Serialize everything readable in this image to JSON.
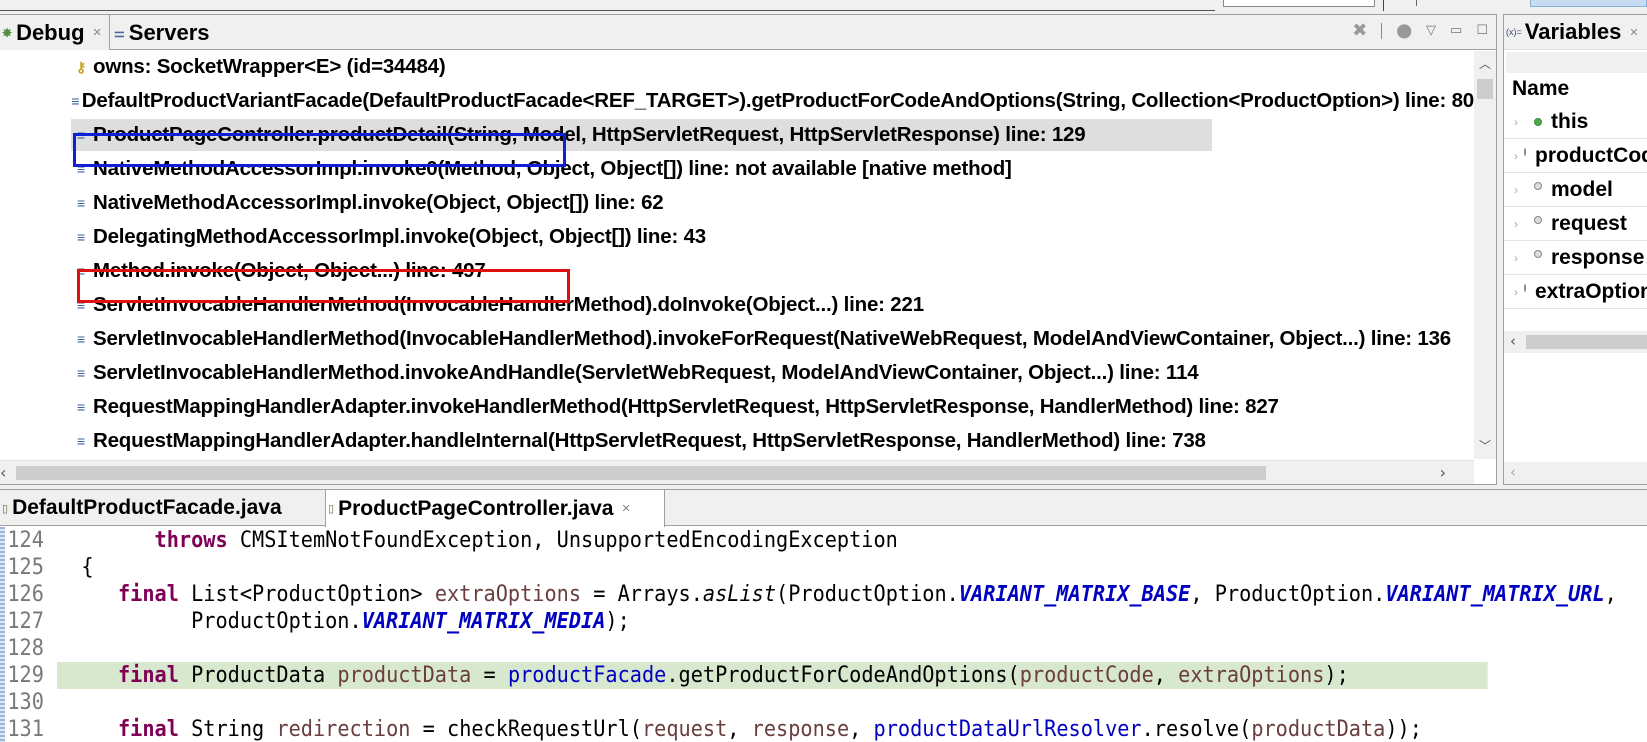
{
  "debug_view": {
    "tabs": [
      {
        "label": "Debug",
        "icon": "bug-icon",
        "closable": true,
        "active": true
      },
      {
        "label": "Servers",
        "icon": "servers-icon",
        "closable": false,
        "active": false
      }
    ],
    "toolbar": [
      "remove-all-terminated-icon",
      "debug-threads-icon",
      "view-menu-icon",
      "minimize-icon",
      "maximize-icon"
    ],
    "stack_frames": [
      {
        "icon": "key-icon",
        "text": "owns: SocketWrapper<E>  (id=34484)"
      },
      {
        "icon": "stack-frame-icon",
        "text": "DefaultProductVariantFacade(DefaultProductFacade<REF_TARGET>).getProductForCodeAndOptions(String, Collection<ProductOption>) line: 80"
      },
      {
        "icon": "stack-frame-icon",
        "text": "ProductPageController.productDetail(String, Model, HttpServletRequest, HttpServletResponse) line: 129",
        "selected": true
      },
      {
        "icon": "stack-frame-icon",
        "text": "NativeMethodAccessorImpl.invoke0(Method, Object, Object[]) line: not available [native method]"
      },
      {
        "icon": "stack-frame-icon",
        "text": "NativeMethodAccessorImpl.invoke(Object, Object[]) line: 62"
      },
      {
        "icon": "stack-frame-icon",
        "text": "DelegatingMethodAccessorImpl.invoke(Object, Object[]) line: 43"
      },
      {
        "icon": "stack-frame-icon",
        "text": "Method.invoke(Object, Object...) line: 497"
      },
      {
        "icon": "stack-frame-icon",
        "text": "ServletInvocableHandlerMethod(InvocableHandlerMethod).doInvoke(Object...) line: 221"
      },
      {
        "icon": "stack-frame-icon",
        "text": "ServletInvocableHandlerMethod(InvocableHandlerMethod).invokeForRequest(NativeWebRequest, ModelAndViewContainer, Object...) line: 136"
      },
      {
        "icon": "stack-frame-icon",
        "text": "ServletInvocableHandlerMethod.invokeAndHandle(ServletWebRequest, ModelAndViewContainer, Object...) line: 114"
      },
      {
        "icon": "stack-frame-icon",
        "text": "RequestMappingHandlerAdapter.invokeHandlerMethod(HttpServletRequest, HttpServletResponse, HandlerMethod) line: 827"
      },
      {
        "icon": "stack-frame-icon",
        "text": "RequestMappingHandlerAdapter.handleInternal(HttpServletRequest, HttpServletResponse, HandlerMethod) line: 738"
      }
    ],
    "annotations": {
      "blue_box_color": "#1020d8",
      "red_box_color": "#e01010"
    }
  },
  "variables_view": {
    "tab": {
      "label": "Variables",
      "icon": "variables-icon",
      "closable": true
    },
    "column_header": "Name",
    "rows": [
      {
        "name": "this",
        "kind": "field"
      },
      {
        "name": "productCode",
        "kind": "local"
      },
      {
        "name": "model",
        "kind": "local"
      },
      {
        "name": "request",
        "kind": "local"
      },
      {
        "name": "response",
        "kind": "local"
      },
      {
        "name": "extraOptions",
        "kind": "local"
      }
    ]
  },
  "editor": {
    "tabs": [
      {
        "label": "DefaultProductFacade.java",
        "icon": "java-file-icon",
        "active": false
      },
      {
        "label": "ProductPageController.java",
        "icon": "java-file-icon",
        "active": true,
        "closable": true
      }
    ],
    "current_line": 129,
    "lines": [
      {
        "num": "124",
        "tokens": [
          [
            "",
            "        "
          ],
          [
            "kw",
            "throws"
          ],
          [
            "",
            " CMSItemNotFoundException, UnsupportedEncodingException"
          ]
        ]
      },
      {
        "num": "125",
        "tokens": [
          [
            "",
            "  {"
          ]
        ]
      },
      {
        "num": "126",
        "tokens": [
          [
            "",
            "     "
          ],
          [
            "kw",
            "final"
          ],
          [
            "",
            " List<ProductOption> "
          ],
          [
            "var",
            "extraOptions"
          ],
          [
            "",
            " = Arrays."
          ],
          [
            "meth-i",
            "asList"
          ],
          [
            "",
            "(ProductOption."
          ],
          [
            "sfld",
            "VARIANT_MATRIX_BASE"
          ],
          [
            "",
            ", ProductOption."
          ],
          [
            "sfld",
            "VARIANT_MATRIX_URL"
          ],
          [
            "",
            ","
          ]
        ]
      },
      {
        "num": "127",
        "tokens": [
          [
            "",
            "           ProductOption."
          ],
          [
            "sfld",
            "VARIANT_MATRIX_MEDIA"
          ],
          [
            "",
            ");"
          ]
        ]
      },
      {
        "num": "128",
        "tokens": [
          [
            "",
            ""
          ]
        ]
      },
      {
        "num": "129",
        "tokens": [
          [
            "",
            "     "
          ],
          [
            "kw",
            "final"
          ],
          [
            "",
            " ProductData "
          ],
          [
            "var",
            "productData"
          ],
          [
            "",
            " = "
          ],
          [
            "fld",
            "productFacade"
          ],
          [
            "",
            ".getProductForCodeAndOptions("
          ],
          [
            "var",
            "productCode"
          ],
          [
            "",
            ", "
          ],
          [
            "var",
            "extraOptions"
          ],
          [
            "",
            ");"
          ]
        ]
      },
      {
        "num": "130",
        "tokens": [
          [
            "",
            ""
          ]
        ]
      },
      {
        "num": "131",
        "tokens": [
          [
            "",
            "     "
          ],
          [
            "kw",
            "final"
          ],
          [
            "",
            " String "
          ],
          [
            "var",
            "redirection"
          ],
          [
            "",
            " = checkRequestUrl("
          ],
          [
            "var",
            "request"
          ],
          [
            "",
            ", "
          ],
          [
            "var",
            "response"
          ],
          [
            "",
            ", "
          ],
          [
            "fld",
            "productDataUrlResolver"
          ],
          [
            "",
            ".resolve("
          ],
          [
            "var",
            "productData"
          ],
          [
            "",
            "));"
          ]
        ]
      }
    ]
  }
}
